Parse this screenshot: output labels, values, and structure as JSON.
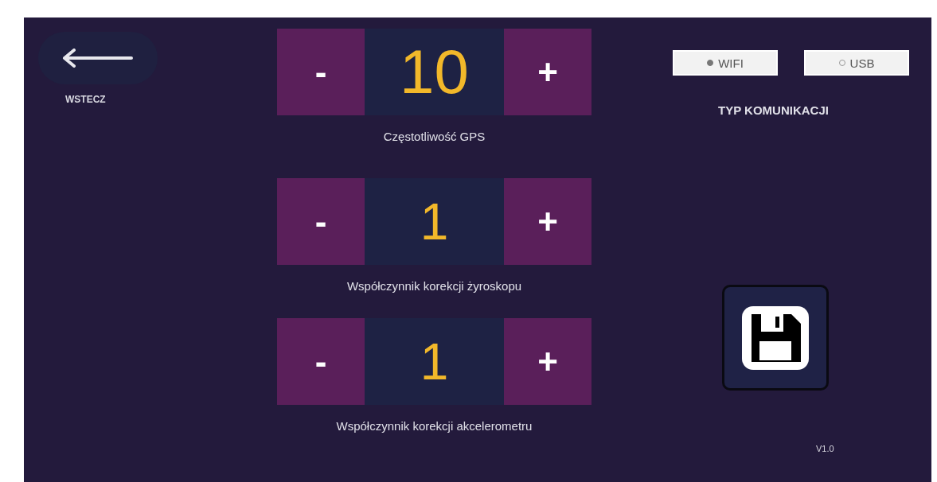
{
  "back": {
    "label": "WSTECZ"
  },
  "steppers": [
    {
      "minus": "-",
      "value": "10",
      "plus": "+",
      "label": "Częstotliwość GPS"
    },
    {
      "minus": "-",
      "value": "1",
      "plus": "+",
      "label": "Współczynnik korekcji żyroskopu"
    },
    {
      "minus": "-",
      "value": "1",
      "plus": "+",
      "label": "Współczynnik korekcji akcelerometru"
    }
  ],
  "communication": {
    "options": [
      {
        "label": "WIFI",
        "selected": true
      },
      {
        "label": "USB",
        "selected": false
      }
    ],
    "label": "TYP KOMUNIKACJI"
  },
  "version": "V1.0"
}
